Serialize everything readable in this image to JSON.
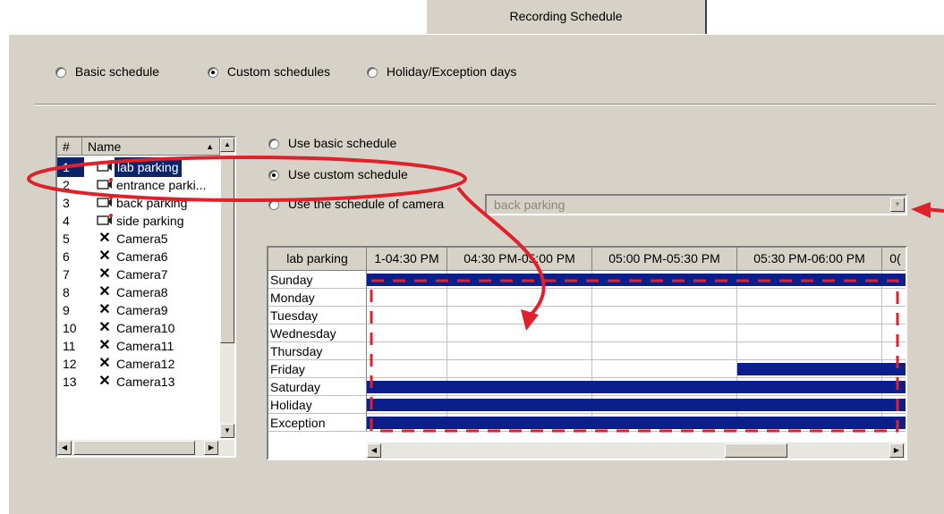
{
  "tab": {
    "label": "Recording Schedule"
  },
  "schedule_mode": {
    "options": [
      "Basic schedule",
      "Custom schedules",
      "Holiday/Exception days"
    ],
    "selected": 1
  },
  "camera_list": {
    "columns": [
      "#",
      "Name"
    ],
    "rows": [
      {
        "num": "1",
        "name": "lab parking",
        "icon": "camera-config-icon",
        "selected": true
      },
      {
        "num": "2",
        "name": "entrance parki...",
        "icon": "camera-config-icon"
      },
      {
        "num": "3",
        "name": "back parking",
        "icon": "camera-config-icon"
      },
      {
        "num": "4",
        "name": "side parking",
        "icon": "camera-config-icon"
      },
      {
        "num": "5",
        "name": "Camera5",
        "icon": "camera-off-icon"
      },
      {
        "num": "6",
        "name": "Camera6",
        "icon": "camera-off-icon"
      },
      {
        "num": "7",
        "name": "Camera7",
        "icon": "camera-off-icon"
      },
      {
        "num": "8",
        "name": "Camera8",
        "icon": "camera-off-icon"
      },
      {
        "num": "9",
        "name": "Camera9",
        "icon": "camera-off-icon"
      },
      {
        "num": "10",
        "name": "Camera10",
        "icon": "camera-off-icon"
      },
      {
        "num": "11",
        "name": "Camera11",
        "icon": "camera-off-icon"
      },
      {
        "num": "12",
        "name": "Camera12",
        "icon": "camera-off-icon"
      },
      {
        "num": "13",
        "name": "Camera13",
        "icon": "camera-off-icon"
      }
    ]
  },
  "schedule_source": {
    "options": [
      "Use basic schedule",
      "Use custom schedule",
      "Use the schedule of camera"
    ],
    "selected": 1
  },
  "camera_dropdown": {
    "value": "back parking"
  },
  "grid": {
    "corner": "lab parking",
    "columns": [
      "1-04:30 PM",
      "04:30 PM-05:00 PM",
      "05:00 PM-05:30 PM",
      "05:30 PM-06:00 PM",
      "0("
    ],
    "days": [
      {
        "name": "Sunday",
        "filled": [
          1,
          1,
          1,
          1,
          1
        ]
      },
      {
        "name": "Monday",
        "filled": [
          0,
          0,
          0,
          0,
          0
        ]
      },
      {
        "name": "Tuesday",
        "filled": [
          0,
          0,
          0,
          0,
          0
        ]
      },
      {
        "name": "Wednesday",
        "filled": [
          0,
          0,
          0,
          0,
          0
        ]
      },
      {
        "name": "Thursday",
        "filled": [
          0,
          0,
          0,
          0,
          0
        ]
      },
      {
        "name": "Friday",
        "filled": [
          0,
          0,
          0,
          1,
          1
        ]
      },
      {
        "name": "Saturday",
        "filled": [
          1,
          1,
          1,
          1,
          1
        ]
      },
      {
        "name": "Holiday",
        "filled": [
          1,
          1,
          1,
          1,
          1
        ]
      },
      {
        "name": "Exception",
        "filled": [
          1,
          1,
          1,
          1,
          1
        ]
      }
    ]
  },
  "colors": {
    "schedule_bar": "#0a1e8c",
    "selection": "#0a246a",
    "annotation": "#e0202a"
  }
}
